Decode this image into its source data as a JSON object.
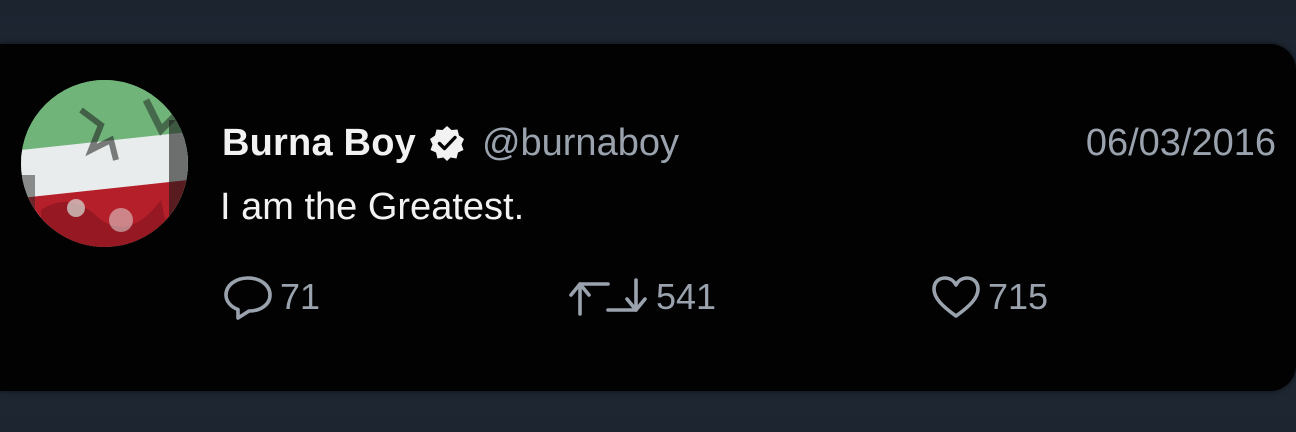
{
  "tweet": {
    "display_name": "Burna Boy",
    "handle": "@burnaboy",
    "date": "06/03/2016",
    "text": "I am the Greatest.",
    "verified": true,
    "avatar_icon": "flag-avatar",
    "actions": {
      "reply": {
        "icon": "reply-icon",
        "count": "71"
      },
      "retweet": {
        "icon": "retweet-icon",
        "count": "541"
      },
      "like": {
        "icon": "heart-icon",
        "count": "715"
      }
    }
  },
  "colors": {
    "page_background": "#1e2733",
    "card_background": "#020203",
    "primary_text": "#f2f2f2",
    "secondary_text": "#9aa3ad"
  }
}
